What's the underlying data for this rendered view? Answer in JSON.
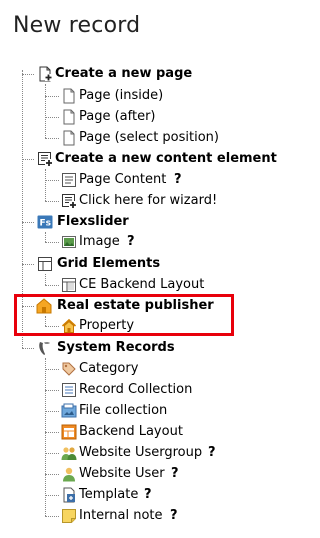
{
  "header": {
    "title": "New record"
  },
  "tree": {
    "pages_group": {
      "label": "Create a new page",
      "icon": "page-new-icon",
      "items": [
        {
          "label": "Page (inside)",
          "icon": "page-icon"
        },
        {
          "label": "Page (after)",
          "icon": "page-icon"
        },
        {
          "label": "Page (select position)",
          "icon": "page-icon"
        }
      ]
    },
    "content_group": {
      "label": "Create a new content element",
      "icon": "content-new-icon",
      "items": [
        {
          "label": "Page Content",
          "icon": "content-icon",
          "help": "?"
        },
        {
          "label": "Click here for wizard!",
          "icon": "content-wizard-icon"
        }
      ]
    },
    "flexslider_group": {
      "label": "Flexslider",
      "icon": "flexslider-icon",
      "items": [
        {
          "label": "Image",
          "icon": "image-icon",
          "help": "?"
        }
      ]
    },
    "grid_group": {
      "label": "Grid Elements",
      "icon": "grid-icon",
      "items": [
        {
          "label": "CE Backend Layout",
          "icon": "backend-layout-icon"
        }
      ]
    },
    "realestate_group": {
      "label": "Real estate publisher",
      "icon": "house-folder-icon",
      "items": [
        {
          "label": "Property",
          "icon": "house-icon"
        }
      ]
    },
    "system_group": {
      "label": "System Records",
      "icon": "typo3-logo-icon",
      "items": [
        {
          "label": "Category",
          "icon": "category-tag-icon"
        },
        {
          "label": "Record Collection",
          "icon": "record-collection-icon"
        },
        {
          "label": "File collection",
          "icon": "file-collection-icon"
        },
        {
          "label": "Backend Layout",
          "icon": "backend-layout-orange-icon"
        },
        {
          "label": "Website Usergroup",
          "icon": "usergroup-icon",
          "help": "?"
        },
        {
          "label": "Website User",
          "icon": "user-icon",
          "help": "?"
        },
        {
          "label": "Template",
          "icon": "template-icon",
          "help": "?"
        },
        {
          "label": "Internal note",
          "icon": "note-icon",
          "help": "?"
        }
      ]
    }
  },
  "colors": {
    "highlight": "#e8000b",
    "tree_line": "#888888"
  }
}
